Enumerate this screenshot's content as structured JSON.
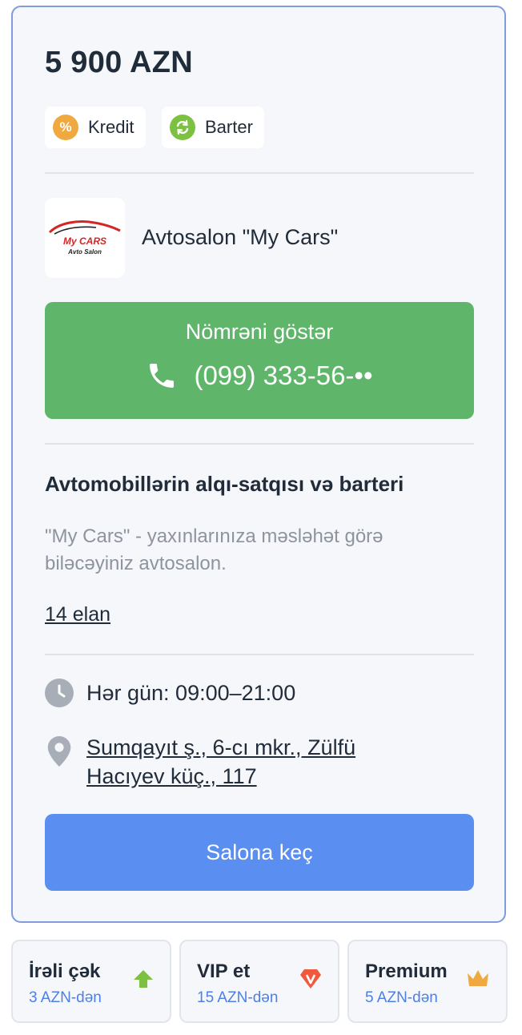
{
  "listing": {
    "price": "5 900 AZN",
    "tags": [
      {
        "label": "Kredit",
        "icon": "percent-icon",
        "color": "#f0a940"
      },
      {
        "label": "Barter",
        "icon": "exchange-icon",
        "color": "#7cc142"
      }
    ]
  },
  "salon": {
    "logo_text_main": "My CARS",
    "logo_text_sub": "Avto Salon",
    "name": "Avtosalon \"My Cars\"",
    "call_button": {
      "label": "Nömrəni göstər",
      "phone": "(099) 333-56-••",
      "icon": "phone-icon",
      "color": "#5fb56a"
    },
    "description_title": "Avtomobillərin alqı-satqısı və barteri",
    "description": "\"My Cars\" - yaxınlarınıza məsləhət görə biləcəyiniz avtosalon.",
    "ads_link": "14 elan",
    "hours": "Hər gün: 09:00–21:00",
    "address": "Sumqayıt ş., 6-cı mkr., Zülfü Hacıyev küç., 117",
    "go_button": {
      "label": "Salona keç",
      "color": "#5a8ef0"
    }
  },
  "promotions": [
    {
      "title": "İrəli çək",
      "price": "3 AZN-dən",
      "icon": "arrow-up-icon",
      "color": "#7cc142"
    },
    {
      "title": "VIP et",
      "price": "15 AZN-dən",
      "icon": "vip-diamond-icon",
      "color": "#f05a3c"
    },
    {
      "title": "Premium",
      "price": "5 AZN-dən",
      "icon": "crown-icon",
      "color": "#f0a940"
    }
  ]
}
